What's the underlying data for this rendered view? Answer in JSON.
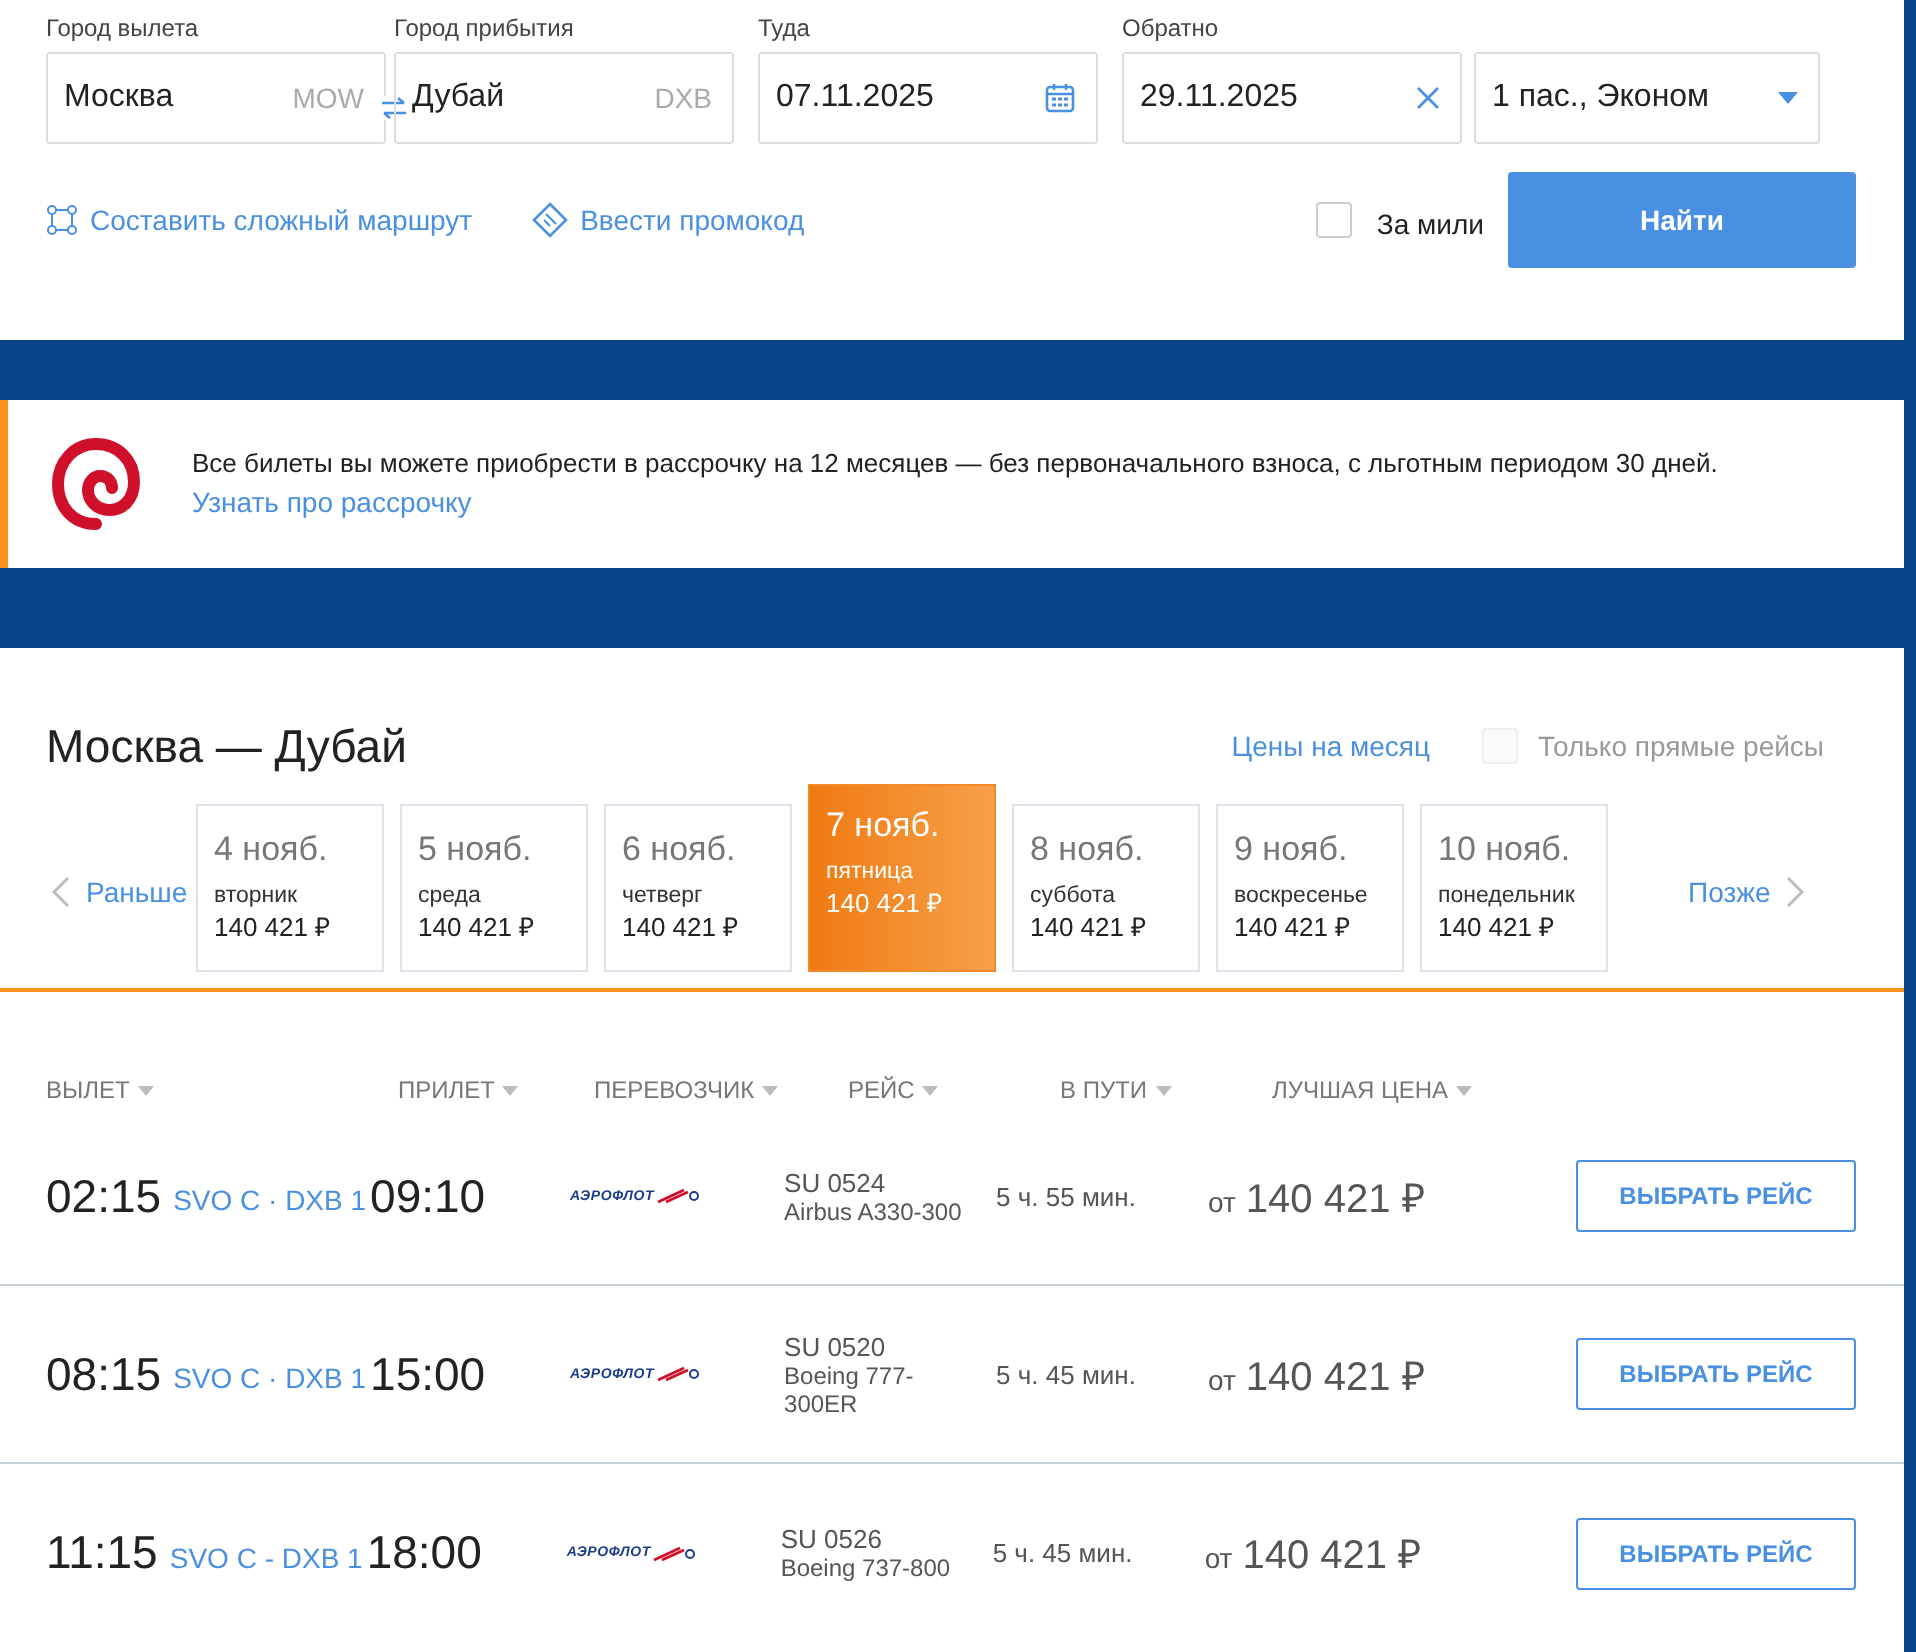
{
  "search": {
    "fields": [
      {
        "kind": "city",
        "label": "Город вылета",
        "value": "Москва",
        "code": "MOW"
      },
      {
        "kind": "city",
        "label": "Город прибытия",
        "value": "Дубай",
        "code": "DXB"
      },
      {
        "kind": "date",
        "label": "Туда",
        "value": "07.11.2025"
      },
      {
        "kind": "clearable",
        "label": "Обратно",
        "value": "29.11.2025"
      },
      {
        "kind": "select",
        "value": "1 пас., Эконом"
      }
    ],
    "complex_route_link": "Составить сложный маршрут",
    "promo_link": "Ввести промокод",
    "miles": {
      "label": "За мили",
      "checked": false
    },
    "submit": "Найти"
  },
  "banner": {
    "text": "Все билеты вы можете приобрести в рассрочку на 12 месяцев — без первоначального взноса, с льготным периодом 30 дней.",
    "link": "Узнать про рассрочку"
  },
  "results": {
    "title": "Москва — Дубай",
    "month_prices_link": "Цены на месяц",
    "direct_only": {
      "label": "Только прямые рейсы",
      "checked": false
    },
    "earlier": "Раньше",
    "later": "Позже",
    "days": [
      {
        "date": "4 нояб.",
        "weekday": "вторник",
        "price": "140 421 ₽",
        "selected": false
      },
      {
        "date": "5 нояб.",
        "weekday": "среда",
        "price": "140 421 ₽",
        "selected": false
      },
      {
        "date": "6 нояб.",
        "weekday": "четверг",
        "price": "140 421 ₽",
        "selected": false
      },
      {
        "date": "7 нояб.",
        "weekday": "пятница",
        "price": "140 421 ₽",
        "selected": true
      },
      {
        "date": "8 нояб.",
        "weekday": "суббота",
        "price": "140 421 ₽",
        "selected": false
      },
      {
        "date": "9 нояб.",
        "weekday": "воскресенье",
        "price": "140 421 ₽",
        "selected": false
      },
      {
        "date": "10 нояб.",
        "weekday": "понедельник",
        "price": "140 421 ₽",
        "selected": false
      }
    ],
    "columns": [
      "ВЫЛЕТ",
      "ПРИЛЕТ",
      "ПЕРЕВОЗЧИК",
      "РЕЙС",
      "В ПУТИ",
      "ЛУЧШАЯ ЦЕНА"
    ],
    "flights": [
      {
        "departure": "02:15",
        "route": "SVO C · DXB 1",
        "arrival": "09:10",
        "carrier": "АЭРОФЛОТ",
        "flight": "SU 0524",
        "aircraft": "Airbus A330-300",
        "duration": "5 ч. 55 мин.",
        "price_prefix": "от",
        "price": "140 421 ₽",
        "button": "ВЫБРАТЬ РЕЙС"
      },
      {
        "departure": "08:15",
        "route": "SVO C · DXB 1",
        "arrival": "15:00",
        "carrier": "АЭРОФЛОТ",
        "flight": "SU 0520",
        "aircraft": "Boeing 777-300ER",
        "duration": "5 ч. 45 мин.",
        "price_prefix": "от",
        "price": "140 421 ₽",
        "button": "ВЫБРАТЬ РЕЙС"
      },
      {
        "departure": "11:15",
        "route": "SVO C - DXB 1",
        "arrival": "18:00",
        "carrier": "АЭРОФЛОТ",
        "flight": "SU 0526",
        "aircraft": "Boeing 737-800",
        "duration": "5 ч. 45 мин.",
        "price_prefix": "от",
        "price": "140 421 ₽",
        "button": "ВЫБРАТЬ РЕЙС"
      }
    ]
  }
}
